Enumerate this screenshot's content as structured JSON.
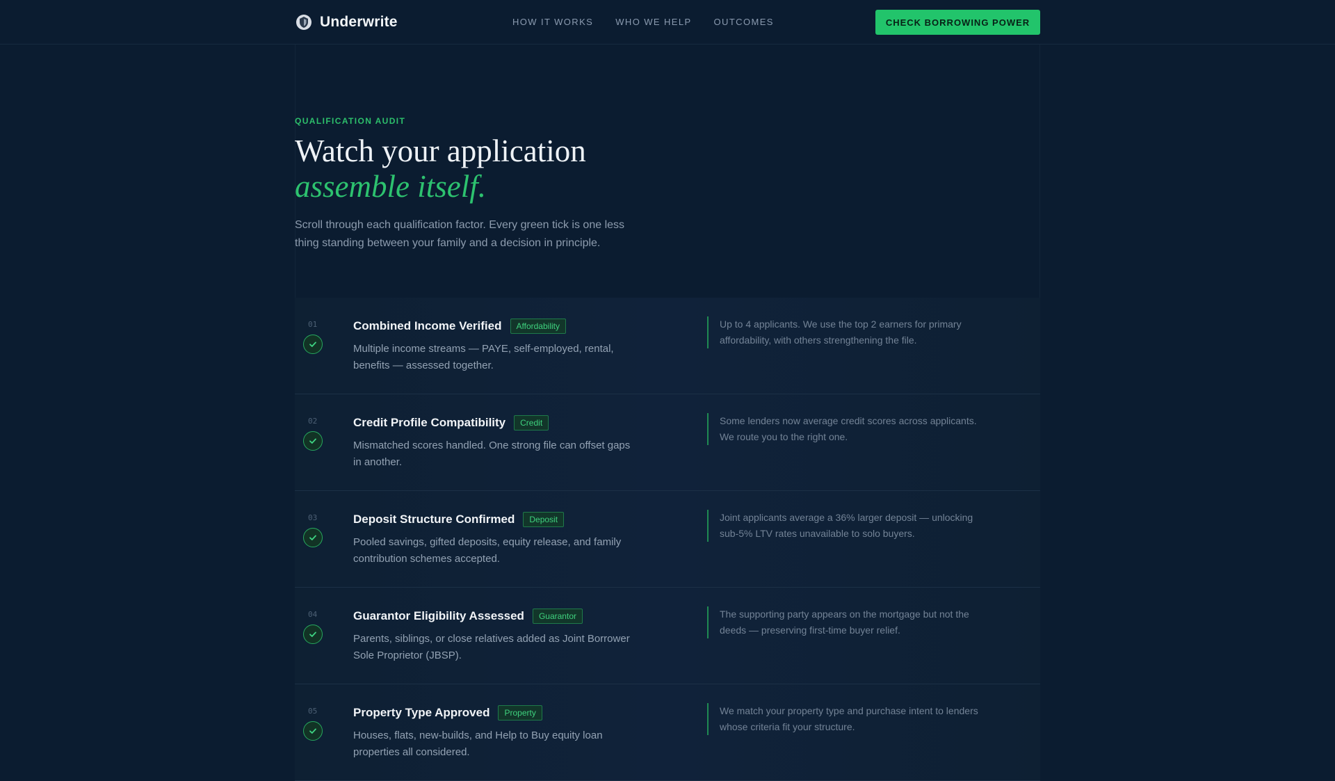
{
  "header": {
    "brand": "Underwrite",
    "nav": [
      "HOW IT WORKS",
      "WHO WE HELP",
      "OUTCOMES"
    ],
    "cta_label": "CHECK BORROWING POWER",
    "brand_icon": "shield-logo-icon"
  },
  "hero": {
    "eyebrow": "QUALIFICATION AUDIT",
    "headline_line1": "Watch your application",
    "headline_line2": "assemble itself.",
    "lede": "Scroll through each qualification factor. Every green tick is one less thing standing between your family and a decision in principle."
  },
  "colors": {
    "background": "#0b1c30",
    "accent": "#22c46b",
    "accent_text": "#2dc26f"
  },
  "factors": [
    {
      "num": "01",
      "title": "Combined Income Verified",
      "tag": "Affordability",
      "desc": "Multiple income streams — PAYE, self-employed, rental, benefits — assessed together.",
      "note": "Up to 4 applicants. We use the top 2 earners for primary affordability, with others strengthening the file."
    },
    {
      "num": "02",
      "title": "Credit Profile Compatibility",
      "tag": "Credit",
      "desc": "Mismatched scores handled. One strong file can offset gaps in another.",
      "note": "Some lenders now average credit scores across applicants. We route you to the right one."
    },
    {
      "num": "03",
      "title": "Deposit Structure Confirmed",
      "tag": "Deposit",
      "desc": "Pooled savings, gifted deposits, equity release, and family contribution schemes accepted.",
      "note": "Joint applicants average a 36% larger deposit — unlocking sub-5% LTV rates unavailable to solo buyers."
    },
    {
      "num": "04",
      "title": "Guarantor Eligibility Assessed",
      "tag": "Guarantor",
      "desc": "Parents, siblings, or close relatives added as Joint Borrower Sole Proprietor (JBSP).",
      "note": "The supporting party appears on the mortgage but not the deeds — preserving first-time buyer relief."
    },
    {
      "num": "05",
      "title": "Property Type Approved",
      "tag": "Property",
      "desc": "Houses, flats, new-builds, and Help to Buy equity loan properties all considered.",
      "note": "We match your property type and purchase intent to lenders whose criteria fit your structure."
    }
  ]
}
